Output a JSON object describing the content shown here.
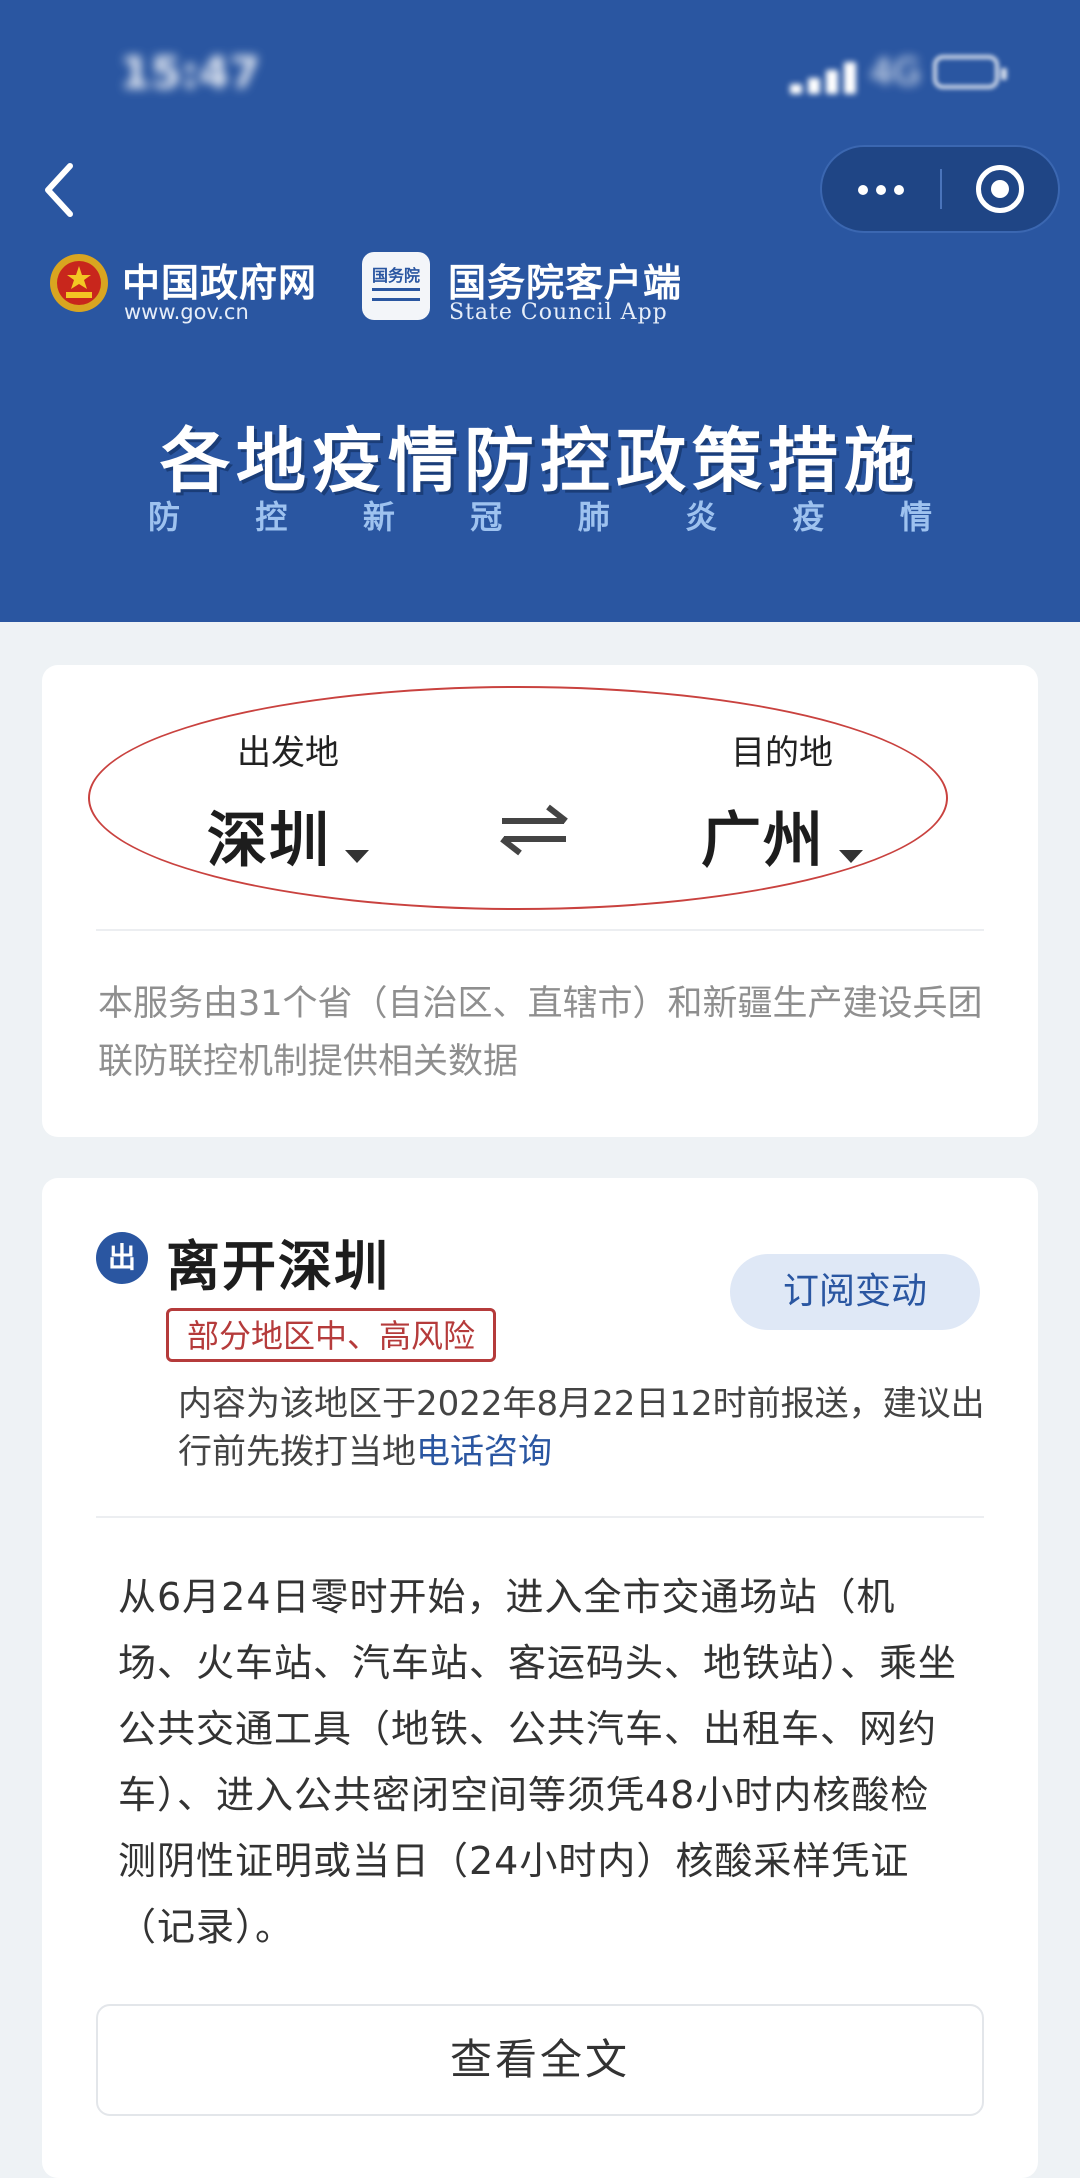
{
  "status_bar": {
    "time": "15:47",
    "network": "4G"
  },
  "nav": {
    "back_icon": "chevron-left-icon",
    "more_icon": "more-dots-icon",
    "close_icon": "mini-program-close-icon"
  },
  "brands": [
    {
      "title": "中国政府网",
      "subtitle": "www.gov.cn"
    },
    {
      "logo_text": "国务院",
      "title": "国务院客户端",
      "subtitle": "State Council App"
    }
  ],
  "banner": {
    "title": "各地疫情防控政策措施",
    "subtitle_chars": [
      "防",
      "控",
      "新",
      "冠",
      "肺",
      "炎",
      "疫",
      "情"
    ]
  },
  "route": {
    "origin_label": "出发地",
    "origin_city": "深圳",
    "destination_label": "目的地",
    "destination_city": "广州",
    "note": "本服务由31个省（自治区、直辖市）和新疆生产建设兵团联防联控机制提供相关数据"
  },
  "departure": {
    "badge": "出",
    "title": "离开深圳",
    "subscribe_label": "订阅变动",
    "risk_tag": "部分地区中、高风险",
    "report_text": "内容为该地区于2022年8月22日12时前报送，建议出行前先拨打当地",
    "phone_link": "电话咨询",
    "policy": "从6月24日零时开始，进入全市交通场站（机场、火车站、汽车站、客运码头、地铁站）、乘坐公共交通工具（地铁、公共汽车、出租车、网约车）、进入公共密闭空间等须凭48小时内核酸检测阴性证明或当日（24小时内）核酸采样凭证（记录）。",
    "full_text_label": "查看全文"
  },
  "colors": {
    "header_blue": "#2a56a1",
    "risk_red": "#b53b3b",
    "page_bg": "#eef2f5"
  }
}
